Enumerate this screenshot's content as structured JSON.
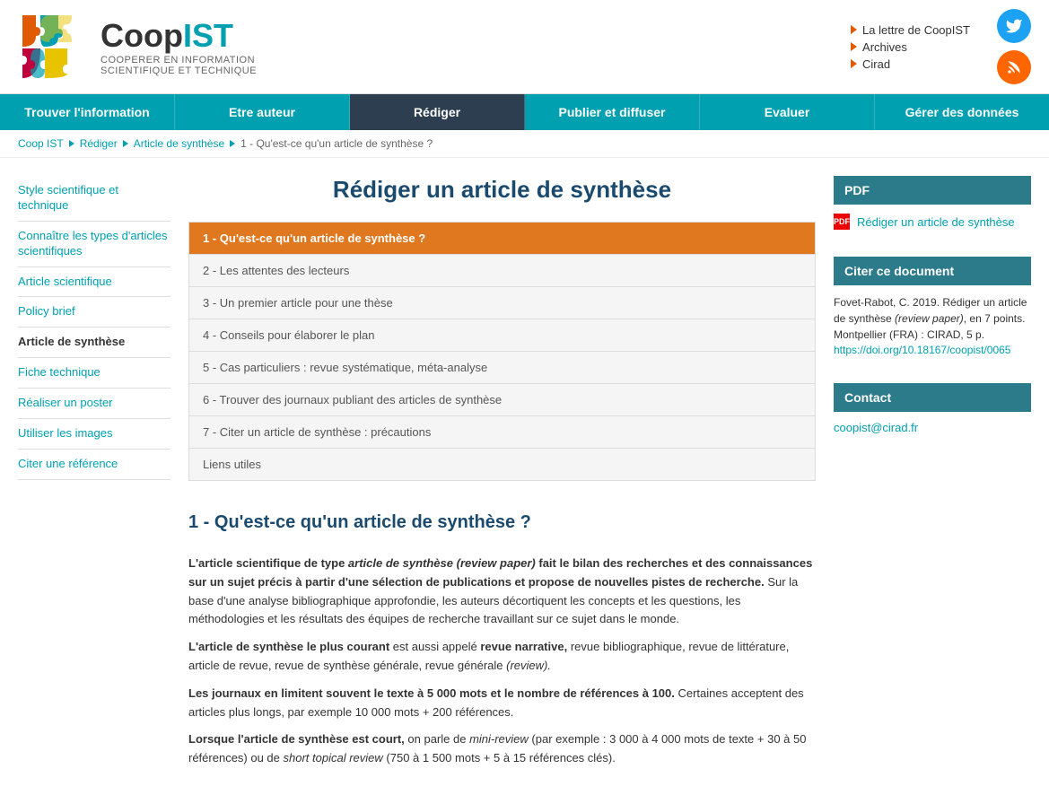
{
  "header": {
    "brand": "CoopIST",
    "brand_prefix": "Coop",
    "brand_suffix": "IST",
    "tagline_line1": "COOPERER EN INFORMATION",
    "tagline_line2": "SCIENTIFIQUE ET TECHNIQUE",
    "links": [
      {
        "label": "La lettre de CoopIST",
        "href": "#"
      },
      {
        "label": "Archives",
        "href": "#"
      },
      {
        "label": "Cirad",
        "href": "#"
      }
    ],
    "social": {
      "twitter_title": "Twitter",
      "rss_title": "RSS"
    }
  },
  "nav": {
    "items": [
      {
        "label": "Trouver l'information",
        "active": false
      },
      {
        "label": "Etre auteur",
        "active": false
      },
      {
        "label": "Rédiger",
        "active": true
      },
      {
        "label": "Publier et diffuser",
        "active": false
      },
      {
        "label": "Evaluer",
        "active": false
      },
      {
        "label": "Gérer des données",
        "active": false
      }
    ]
  },
  "breadcrumb": {
    "items": [
      {
        "label": "Coop IST",
        "href": "#"
      },
      {
        "label": "Rédiger",
        "href": "#"
      },
      {
        "label": "Article de synthèse",
        "href": "#"
      },
      {
        "label": "1 - Qu'est-ce qu'un article de synthèse ?",
        "href": "#"
      }
    ]
  },
  "sidebar_left": {
    "items": [
      {
        "label": "Style scientifique et technique",
        "href": "#",
        "active": false
      },
      {
        "label": "Connaître les types d'articles scientifiques",
        "href": "#",
        "active": false
      },
      {
        "label": "Article scientifique",
        "href": "#",
        "active": false
      },
      {
        "label": "Policy brief",
        "href": "#",
        "active": false
      },
      {
        "label": "Article de synthèse",
        "href": "#",
        "active": true
      },
      {
        "label": "Fiche technique",
        "href": "#",
        "active": false
      },
      {
        "label": "Réaliser un poster",
        "href": "#",
        "active": false
      },
      {
        "label": "Utiliser les images",
        "href": "#",
        "active": false
      },
      {
        "label": "Citer une référence",
        "href": "#",
        "active": false
      }
    ]
  },
  "main": {
    "page_title": "Rédiger un article de synthèse",
    "toc": [
      {
        "label": "1 - Qu'est-ce qu'un article de synthèse ?",
        "active": true
      },
      {
        "label": "2 - Les attentes des lecteurs",
        "active": false
      },
      {
        "label": "3 - Un premier article pour une thèse",
        "active": false
      },
      {
        "label": "4 - Conseils pour élaborer le plan",
        "active": false
      },
      {
        "label": "5 - Cas particuliers : revue systématique, méta-analyse",
        "active": false
      },
      {
        "label": "6 - Trouver des journaux publiant des articles de synthèse",
        "active": false
      },
      {
        "label": "7 - Citer un article de synthèse : précautions",
        "active": false
      },
      {
        "label": "Liens utiles",
        "active": false
      }
    ],
    "section1": {
      "title": "1 - Qu'est-ce qu'un article de synthèse ?",
      "paragraphs": [
        {
          "html": "<strong>L'article scientifique de type <em>article de synthèse</em> <em>(review paper)</em> fait le bilan des recherches et des connaissances sur un sujet précis à partir d'une sélection de publications et propose de nouvelles pistes de recherche.</strong> Sur la base d'une analyse bibliographique approfondie, les auteurs décortiquent les concepts et les questions, les méthodologies et les résultats des équipes de recherche travaillant sur ce sujet dans le monde."
        },
        {
          "html": "<strong>L'article de synthèse le plus courant</strong> est aussi appelé <strong>revue narrative,</strong> revue bibliographique, revue de littérature, article de revue, revue de synthèse générale, revue générale <em>(review).</em>"
        },
        {
          "html": "<strong>Les journaux en limitent souvent le texte à 5 000 mots et le nombre de références à 100.</strong> Certaines acceptent des articles plus longs, par exemple 10 000 mots + 200 références."
        },
        {
          "html": "<strong>Lorsque l'article de synthèse est court,</strong> on parle de <em>mini-review</em> (par exemple : 3 000 à 4 000 mots de texte + 30 à 50 références) ou de <em>short topical review</em> (750 à 1 500 mots + 5 à 15 références clés)."
        }
      ]
    }
  },
  "sidebar_right": {
    "pdf_box": {
      "title": "PDF",
      "link_label": "Rédiger un article de synthèse",
      "link_href": "#"
    },
    "cite_box": {
      "title": "Citer ce document",
      "text": "Fovet-Rabot, C. 2019. Rédiger un article de synthèse (review paper), en 7 points. Montpellier (FRA) : CIRAD, 5 p.",
      "doi_label": "https://doi.org/10.18167/coopist/0065",
      "doi_href": "#"
    },
    "contact_box": {
      "title": "Contact",
      "email": "coopist@cirad.fr",
      "email_href": "mailto:coopist@cirad.fr"
    }
  }
}
